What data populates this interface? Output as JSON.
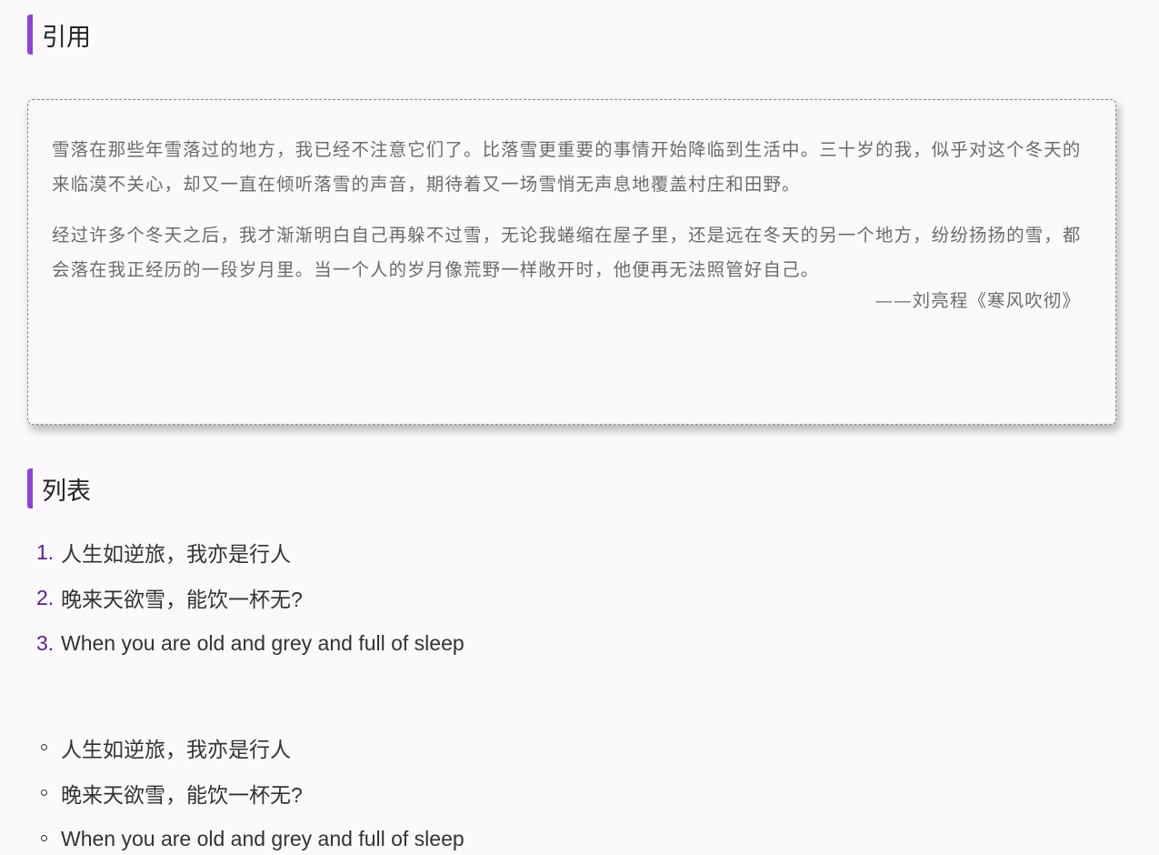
{
  "quote_section": {
    "title": "引用",
    "paragraphs": [
      "雪落在那些年雪落过的地方，我已经不注意它们了。比落雪更重要的事情开始降临到生活中。三十岁的我，似乎对这个冬天的来临漠不关心，却又一直在倾听落雪的声音，期待着又一场雪悄无声息地覆盖村庄和田野。",
      "经过许多个冬天之后，我才渐渐明白自己再躲不过雪，无论我蜷缩在屋子里，还是远在冬天的另一个地方，纷纷扬扬的雪，都会落在我正经历的一段岁月里。当一个人的岁月像荒野一样敞开时，他便再无法照管好自己。"
    ],
    "source": "——刘亮程《寒风吹彻》"
  },
  "list_section": {
    "title": "列表",
    "ordered": [
      {
        "marker": "1.",
        "text": "人生如逆旅，我亦是行人"
      },
      {
        "marker": "2.",
        "text": "晚来天欲雪，能饮一杯无?"
      },
      {
        "marker": "3.",
        "text": "When you are old and grey and full of sleep"
      }
    ],
    "unordered": [
      {
        "text": "人生如逆旅，我亦是行人"
      },
      {
        "text": "晚来天欲雪，能饮一杯无?"
      },
      {
        "text": "When you are old and grey and full of sleep"
      }
    ]
  },
  "colors": {
    "accent": "#8e44d0",
    "marker": "#5a1f86",
    "background": "#fbf9fc"
  }
}
